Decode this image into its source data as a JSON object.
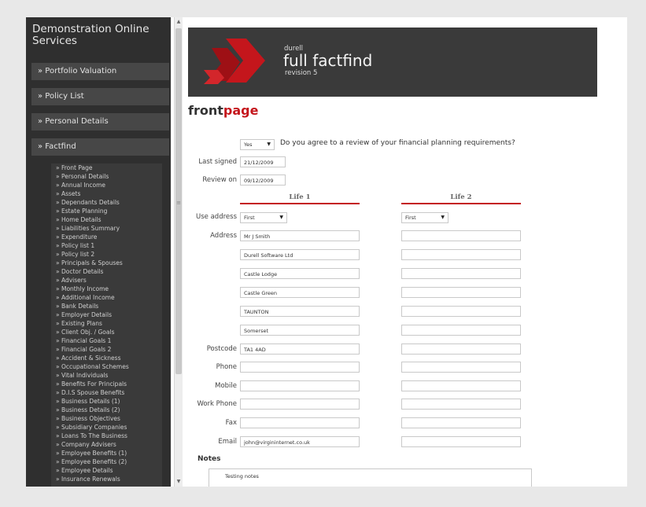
{
  "sidebar": {
    "title": "Demonstration Online Services",
    "nav": [
      {
        "label": "» Portfolio Valuation"
      },
      {
        "label": "» Policy List"
      },
      {
        "label": "» Personal Details"
      },
      {
        "label": "» Factfind"
      }
    ],
    "subitems": [
      "» Front Page",
      "» Personal Details",
      "» Annual Income",
      "» Assets",
      "» Dependants Details",
      "» Estate Planning",
      "» Home Details",
      "» Liabilities Summary",
      "» Expenditure",
      "» Policy list 1",
      "» Policy list 2",
      "» Principals & Spouses",
      "» Doctor Details",
      "» Advisers",
      "» Monthly Income",
      "» Additional Income",
      "» Bank Details",
      "» Employer Details",
      "» Existing Plans",
      "» Client Obj. / Goals",
      "» Financial Goals 1",
      "» Financial Goals 2",
      "» Accident & Sickness",
      "» Occupational Schemes",
      "» Vital Individuals",
      "» Benefits For Principals",
      "» D.I.S Spouse Benefits",
      "» Business Details (1)",
      "» Business Details (2)",
      "» Business Objectives",
      "» Subsidiary Companies",
      "» Loans To The Business",
      "» Company Advisers",
      "» Employee Benefits (1)",
      "» Employee Benefits (2)",
      "» Employee Details",
      "» Insurance Renewals"
    ]
  },
  "banner": {
    "brand_small": "durell",
    "brand_big": "full factfind",
    "revision": "revision 5",
    "colors": {
      "logo": "#c4161c",
      "bg": "#3a3a3a"
    }
  },
  "page": {
    "title_part1": "front",
    "title_part2": "page"
  },
  "form": {
    "agree_value": "Yes",
    "agree_question": "Do you agree to a review of your financial planning requirements?",
    "last_signed_label": "Last signed",
    "last_signed_value": "21/12/2009",
    "review_on_label": "Review on",
    "review_on_value": "09/12/2009",
    "life1_heading": "Life 1",
    "life2_heading": "Life 2",
    "use_address_label": "Use address",
    "use_address_life1": "First",
    "use_address_life2": "First",
    "address_label": "Address",
    "address_lines_life1": [
      "Mr J Smith",
      "Durell Software Ltd",
      "Castle Lodge",
      "Castle Green",
      "TAUNTON",
      "Somerset"
    ],
    "address_lines_life2": [
      "",
      "",
      "",
      "",
      "",
      ""
    ],
    "postcode_label": "Postcode",
    "postcode_life1": "TA1 4AD",
    "postcode_life2": "",
    "phone_label": "Phone",
    "phone_life1": "",
    "phone_life2": "",
    "mobile_label": "Mobile",
    "mobile_life1": "",
    "mobile_life2": "",
    "work_phone_label": "Work Phone",
    "work_phone_life1": "",
    "work_phone_life2": "",
    "fax_label": "Fax",
    "fax_life1": "",
    "fax_life2": "",
    "email_label": "Email",
    "email_life1": "john@virgininternet.co.uk",
    "email_life2": "",
    "notes_label": "Notes",
    "notes_value": "Testing notes"
  }
}
